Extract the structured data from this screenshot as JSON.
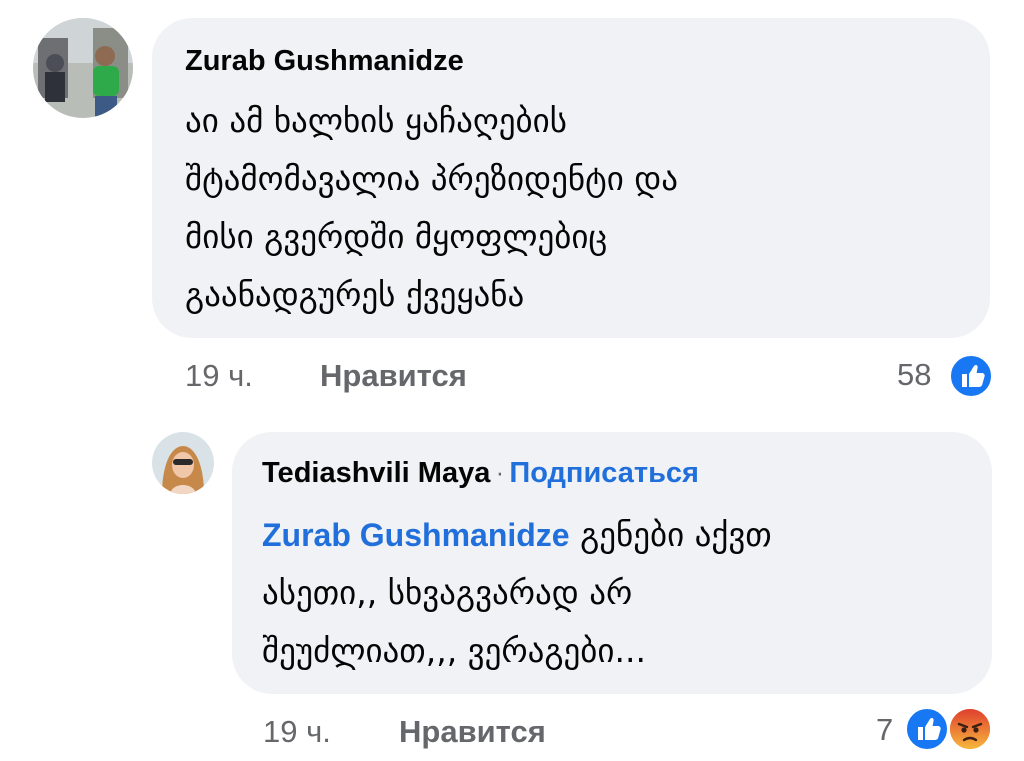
{
  "comment": {
    "author": "Zurab Gushmanidze",
    "lines": [
      "აი ამ ხალხის ყაჩაღების",
      "შტამომავალია პრეზიდენტი და",
      "მისი გვერდში მყოფლებიც",
      "გაანადგურეს ქვეყანა"
    ],
    "time": "19 ч.",
    "like_label": "Нравится",
    "reaction_count": "58",
    "reactions": [
      "like-icon"
    ]
  },
  "reply": {
    "author": "Tediashvili Maya",
    "separator": "·",
    "follow_label": "Подписаться",
    "mention": "Zurab Gushmanidze",
    "first_line_rest": " გენები აქვთ",
    "lines": [
      "ასეთი,, სხვაგვარად  არ",
      "შეუძლიათ,,, ვერაგები..."
    ],
    "time": "19 ч.",
    "like_label": "Нравится",
    "reaction_count": "7",
    "reactions": [
      "like-icon",
      "angry-icon"
    ]
  },
  "colors": {
    "bubble": "#f0f2f5",
    "link": "#216fdb",
    "meta": "#65676b",
    "like_blue": "#1877f2",
    "angry_orange": "#e9710f"
  }
}
